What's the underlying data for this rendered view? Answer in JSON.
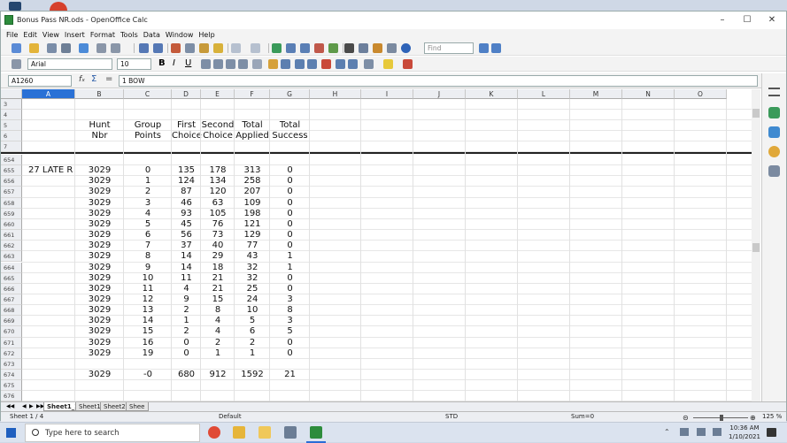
{
  "window": {
    "title": "Bonus Pass NR.ods - OpenOffice Calc"
  },
  "menus": [
    "File",
    "Edit",
    "View",
    "Insert",
    "Format",
    "Tools",
    "Data",
    "Window",
    "Help"
  ],
  "toolbar": {
    "find_placeholder": "Find"
  },
  "formatting": {
    "font_name": "Arial",
    "font_size": "10"
  },
  "formula": {
    "name_box": "A1260",
    "content": "1 BOW"
  },
  "columns": [
    "A",
    "B",
    "C",
    "D",
    "E",
    "F",
    "G",
    "H",
    "I",
    "J",
    "K",
    "L",
    "M",
    "N",
    "O"
  ],
  "frozen_rows": [
    {
      "num": "3",
      "cells": [
        "",
        "",
        "",
        "",
        "",
        "",
        ""
      ]
    },
    {
      "num": "4",
      "cells": [
        "",
        "",
        "",
        "",
        "",
        "",
        ""
      ]
    },
    {
      "num": "5",
      "cells": [
        "",
        "Hunt",
        "Group",
        "First",
        "Second",
        "Total",
        "Total"
      ]
    },
    {
      "num": "6",
      "cells": [
        "",
        "Nbr",
        "Points",
        "Choice",
        "Choice",
        "Applied",
        "Success"
      ]
    },
    {
      "num": "7",
      "cells": [
        "",
        "",
        "",
        "",
        "",
        "",
        ""
      ]
    }
  ],
  "rows": [
    {
      "num": "654",
      "cells": [
        "",
        "",
        "",
        "",
        "",
        "",
        ""
      ]
    },
    {
      "num": "655",
      "cells": [
        "27 LATE R",
        "3029",
        "0",
        "135",
        "178",
        "313",
        "0"
      ]
    },
    {
      "num": "656",
      "cells": [
        "",
        "3029",
        "1",
        "124",
        "134",
        "258",
        "0"
      ]
    },
    {
      "num": "657",
      "cells": [
        "",
        "3029",
        "2",
        "87",
        "120",
        "207",
        "0"
      ]
    },
    {
      "num": "658",
      "cells": [
        "",
        "3029",
        "3",
        "46",
        "63",
        "109",
        "0"
      ]
    },
    {
      "num": "659",
      "cells": [
        "",
        "3029",
        "4",
        "93",
        "105",
        "198",
        "0"
      ]
    },
    {
      "num": "660",
      "cells": [
        "",
        "3029",
        "5",
        "45",
        "76",
        "121",
        "0"
      ]
    },
    {
      "num": "661",
      "cells": [
        "",
        "3029",
        "6",
        "56",
        "73",
        "129",
        "0"
      ]
    },
    {
      "num": "662",
      "cells": [
        "",
        "3029",
        "7",
        "37",
        "40",
        "77",
        "0"
      ]
    },
    {
      "num": "663",
      "cells": [
        "",
        "3029",
        "8",
        "14",
        "29",
        "43",
        "1"
      ]
    },
    {
      "num": "664",
      "cells": [
        "",
        "3029",
        "9",
        "14",
        "18",
        "32",
        "1"
      ]
    },
    {
      "num": "665",
      "cells": [
        "",
        "3029",
        "10",
        "11",
        "21",
        "32",
        "0"
      ]
    },
    {
      "num": "666",
      "cells": [
        "",
        "3029",
        "11",
        "4",
        "21",
        "25",
        "0"
      ]
    },
    {
      "num": "667",
      "cells": [
        "",
        "3029",
        "12",
        "9",
        "15",
        "24",
        "3"
      ]
    },
    {
      "num": "668",
      "cells": [
        "",
        "3029",
        "13",
        "2",
        "8",
        "10",
        "8"
      ]
    },
    {
      "num": "669",
      "cells": [
        "",
        "3029",
        "14",
        "1",
        "4",
        "5",
        "3"
      ]
    },
    {
      "num": "670",
      "cells": [
        "",
        "3029",
        "15",
        "2",
        "4",
        "6",
        "5"
      ]
    },
    {
      "num": "671",
      "cells": [
        "",
        "3029",
        "16",
        "0",
        "2",
        "2",
        "0"
      ]
    },
    {
      "num": "672",
      "cells": [
        "",
        "3029",
        "19",
        "0",
        "1",
        "1",
        "0"
      ]
    },
    {
      "num": "673",
      "cells": [
        "",
        "",
        "",
        "",
        "",
        "",
        ""
      ]
    },
    {
      "num": "674",
      "cells": [
        "",
        "3029",
        "-0",
        "680",
        "912",
        "1592",
        "21"
      ]
    },
    {
      "num": "675",
      "cells": [
        "",
        "",
        "",
        "",
        "",
        "",
        ""
      ]
    },
    {
      "num": "676",
      "cells": [
        "",
        "",
        "",
        "",
        "",
        "",
        ""
      ]
    }
  ],
  "sheet_tabs": [
    "Sheet1_2",
    "Sheet1",
    "Sheet2",
    "Shee"
  ],
  "status": {
    "sheet": "Sheet 1 / 4",
    "style": "Default",
    "mode": "STD",
    "sum": "Sum=0",
    "zoom": "125 %"
  },
  "taskbar": {
    "search_placeholder": "Type here to search",
    "time": "10:36 AM",
    "date": "1/10/2021"
  }
}
